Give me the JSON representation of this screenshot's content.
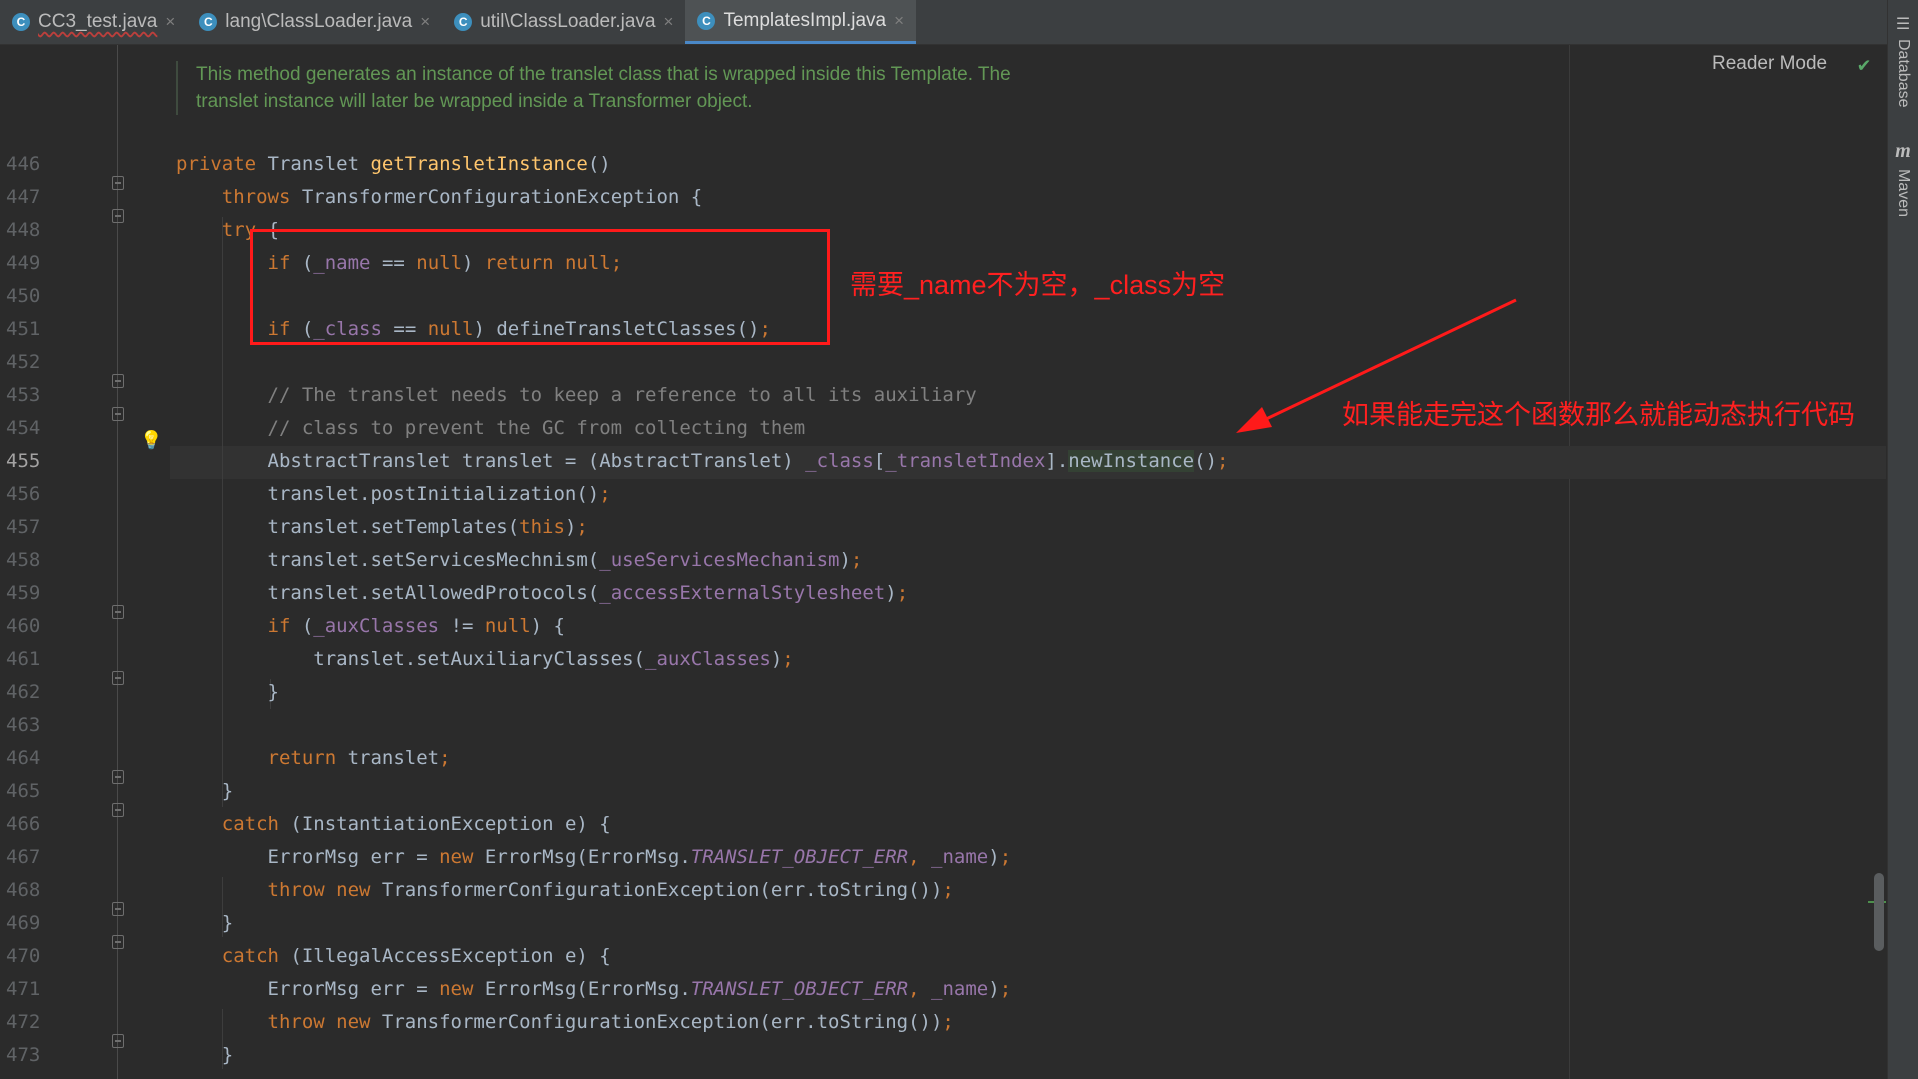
{
  "tabs": [
    {
      "label": "CC3_test.java",
      "icon": "class-icon",
      "error": true
    },
    {
      "label": "lang\\ClassLoader.java",
      "icon": "class-icon",
      "error": false
    },
    {
      "label": "util\\ClassLoader.java",
      "icon": "class-icon",
      "error": false
    },
    {
      "label": "TemplatesImpl.java",
      "icon": "class-icon",
      "error": false,
      "active": true
    }
  ],
  "toolwindows": {
    "database": "Database",
    "maven": "Maven"
  },
  "editor": {
    "reader_mode": "Reader Mode",
    "doc_comment": [
      "This method generates an instance of the translet class that is wrapped inside this Template. The",
      "translet instance will later be wrapped inside a Transformer object."
    ],
    "line_numbers": [
      "446",
      "447",
      "448",
      "449",
      "450",
      "451",
      "452",
      "453",
      "454",
      "455",
      "456",
      "457",
      "458",
      "459",
      "460",
      "461",
      "462",
      "463",
      "464",
      "465",
      "466",
      "467",
      "468",
      "469",
      "470",
      "471",
      "472",
      "473"
    ],
    "current_line": "455"
  },
  "annotations": {
    "box_note": "需要_name不为空，_class为空",
    "arrow_note": "如果能走完这个函数那么就能动态执行代码"
  },
  "colors": {
    "background": "#2b2b2b",
    "keyword": "#cc7832",
    "function": "#ffc66d",
    "field": "#9876aa",
    "comment": "#808080",
    "doc": "#629755",
    "annotation": "#ff2020"
  }
}
